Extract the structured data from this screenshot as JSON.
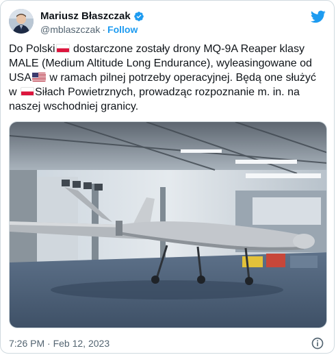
{
  "author": {
    "name": "Mariusz Błaszczak",
    "handle": "@mblaszczak",
    "follow_label": "Follow"
  },
  "tweet": {
    "parts": [
      "Do Polski",
      " dostarczone zostały drony MQ-9A Reaper klasy MALE (Medium Altitude Long Endurance), wyleasingowane od USA",
      " w ramach pilnej potrzeby operacyjnej. Będą one służyć w ",
      "Siłach Powietrznych, prowadząc rozpoznanie m. in. na naszej wschodniej granicy."
    ]
  },
  "media": {
    "icons": [
      "flag-poland",
      "flag-usa"
    ],
    "photo_description_icon": "drone-in-hangar-photo"
  },
  "meta": {
    "time": "7:26 PM",
    "separator": "·",
    "date": "Feb 12, 2023"
  },
  "icons": {
    "verified": "verified-badge-icon",
    "brand": "twitter-bird-icon",
    "info": "info-icon"
  },
  "colors": {
    "accent": "#1d9bf0",
    "text": "#0f1419",
    "secondary": "#536471"
  }
}
